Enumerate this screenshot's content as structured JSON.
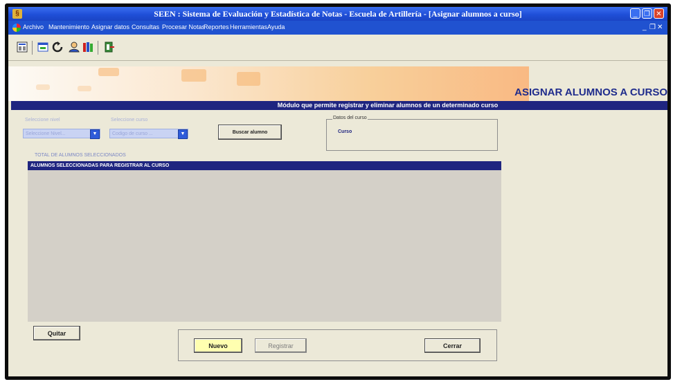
{
  "window": {
    "title": "SEEN : Sistema de Evaluación y Estadística de Notas - Escuela de Artillería - [Asignar alumnos a curso]"
  },
  "menu": {
    "items": [
      "Archivo",
      "Mantenimiento",
      "Asignar datos",
      "Consultas",
      "Procesar Notas",
      "Reportes",
      "Herramientas",
      "Ayuda"
    ]
  },
  "banner": {
    "title": "ASIGNAR  ALUMNOS A CURSO",
    "subtitle": "Módulo que permite registrar y eliminar alumnos de un determinado curso"
  },
  "filters": {
    "nivel_label": "Seleccione nivel",
    "nivel_value": "Seleccione Nivel...",
    "curso_label": "Seleccione curso",
    "curso_value": "Codigo de curso ...",
    "buscar_label": "Buscar alumno"
  },
  "datos_curso": {
    "legend": "Datos del curso",
    "curso_label": "Curso"
  },
  "alumnos": {
    "total_label": "TOTAL DE ALUMNOS SELECCIONADOS",
    "header": "ALUMNOS SELECCIONADAS PARA REGISTRAR AL CURSO"
  },
  "actions": {
    "quitar": "Quitar",
    "nuevo": "Nuevo",
    "registrar": "Registrar",
    "cerrar": "Cerrar"
  },
  "colors": {
    "titlebar": "#2052d0",
    "banner_text": "#1f2c8c",
    "header_bar": "#1f2580",
    "nuevo_bg": "#ffffb0"
  }
}
